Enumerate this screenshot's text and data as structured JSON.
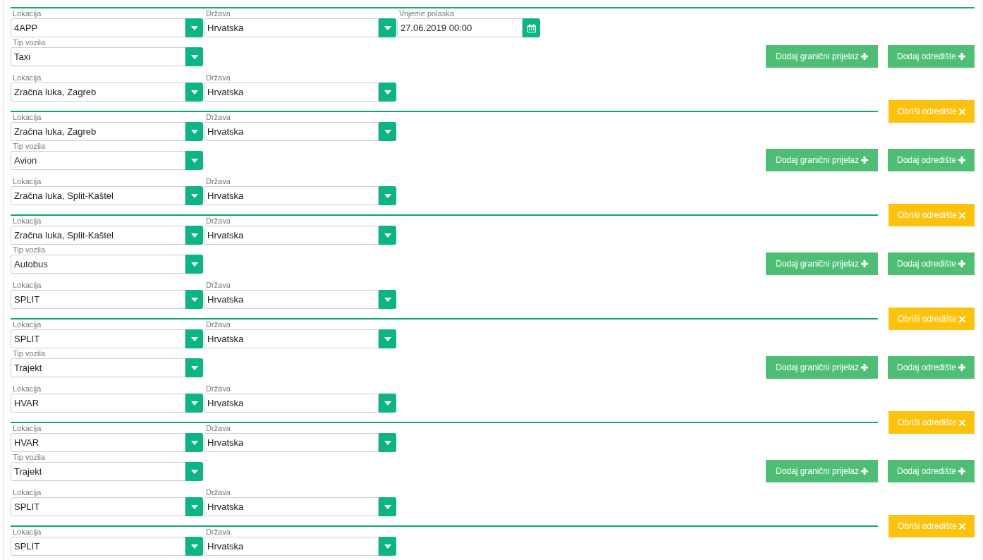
{
  "legs": [
    {
      "from": {
        "location_label": "Lokacija",
        "location": "4APP",
        "country_label": "Država",
        "country": "Hrvatska",
        "departure_label": "Vrijeme polaska",
        "departure": "27.06.2019 00:00"
      },
      "vehicle_label": "Tip vozila",
      "vehicle": "Taxi",
      "to": {
        "location_label": "Lokacija",
        "location": "Zračna luka, Zagreb",
        "country_label": "Država",
        "country": "Hrvatska"
      },
      "add_crossing_button": "Dodaj granični prijelaz",
      "add_destination_button": "Dodaj odredište",
      "remove_button": "Obriši odredište"
    },
    {
      "from": {
        "location_label": "Lokacija",
        "location": "Zračna luka, Zagreb",
        "country_label": "Država",
        "country": "Hrvatska"
      },
      "vehicle_label": "Tip vozila",
      "vehicle": "Avion",
      "to": {
        "location_label": "Lokacija",
        "location": "Zračna luka, Split-Kaštel",
        "country_label": "Država",
        "country": "Hrvatska"
      },
      "add_crossing_button": "Dodaj granični prijelaz",
      "add_destination_button": "Dodaj odredište",
      "remove_button": "Obriši odredište"
    },
    {
      "from": {
        "location_label": "Lokacija",
        "location": "Zračna luka, Split-Kaštel",
        "country_label": "Država",
        "country": "Hrvatska"
      },
      "vehicle_label": "Tip vozila",
      "vehicle": "Autobus",
      "to": {
        "location_label": "Lokacija",
        "location": "SPLIT",
        "country_label": "Država",
        "country": "Hrvatska"
      },
      "add_crossing_button": "Dodaj granični prijelaz",
      "add_destination_button": "Dodaj odredište",
      "remove_button": "Obriši odredište"
    },
    {
      "from": {
        "location_label": "Lokacija",
        "location": "SPLIT",
        "country_label": "Država",
        "country": "Hrvatska"
      },
      "vehicle_label": "Tip vozila",
      "vehicle": "Trajekt",
      "to": {
        "location_label": "Lokacija",
        "location": "HVAR",
        "country_label": "Država",
        "country": "Hrvatska"
      },
      "add_crossing_button": "Dodaj granični prijelaz",
      "add_destination_button": "Dodaj odredište",
      "remove_button": "Obriši odredište"
    },
    {
      "from": {
        "location_label": "Lokacija",
        "location": "HVAR",
        "country_label": "Država",
        "country": "Hrvatska"
      },
      "vehicle_label": "Tip vozila",
      "vehicle": "Trajekt",
      "to": {
        "location_label": "Lokacija",
        "location": "SPLIT",
        "country_label": "Država",
        "country": "Hrvatska"
      },
      "add_crossing_button": "Dodaj granični prijelaz",
      "add_destination_button": "Dodaj odredište",
      "remove_button": "Obriši odredište"
    },
    {
      "from": {
        "location_label": "Lokacija",
        "location": "SPLIT",
        "country_label": "Država",
        "country": "Hrvatska"
      }
    }
  ]
}
